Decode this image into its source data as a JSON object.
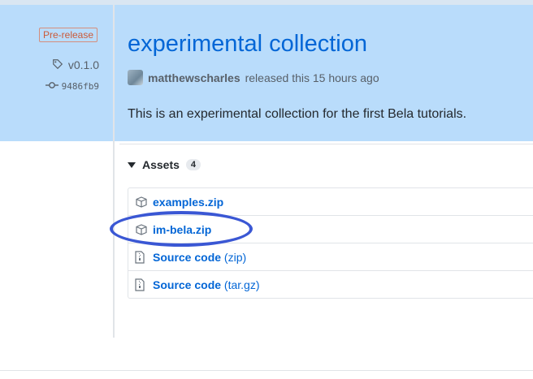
{
  "release": {
    "prerelease_label": "Pre-release",
    "tag": "v0.1.0",
    "commit": "9486fb9",
    "title": "experimental collection",
    "author": "matthewscharles",
    "released_text": "released this 15 hours ago",
    "description": "This is an experimental collection for the first Bela tutorials."
  },
  "assets": {
    "label": "Assets",
    "count": "4",
    "items": [
      {
        "name": "examples.zip",
        "suffix": "",
        "icon": "package-icon"
      },
      {
        "name": "im-bela.zip",
        "suffix": "",
        "icon": "package-icon"
      },
      {
        "name": "Source code",
        "suffix": "(zip)",
        "icon": "file-zip-icon"
      },
      {
        "name": "Source code",
        "suffix": "(tar.gz)",
        "icon": "file-zip-icon"
      }
    ]
  },
  "colors": {
    "highlight": "#b9dcfb",
    "link": "#0366d6",
    "prerelease": "#cb5a3a",
    "annotation": "#3a57d4"
  }
}
